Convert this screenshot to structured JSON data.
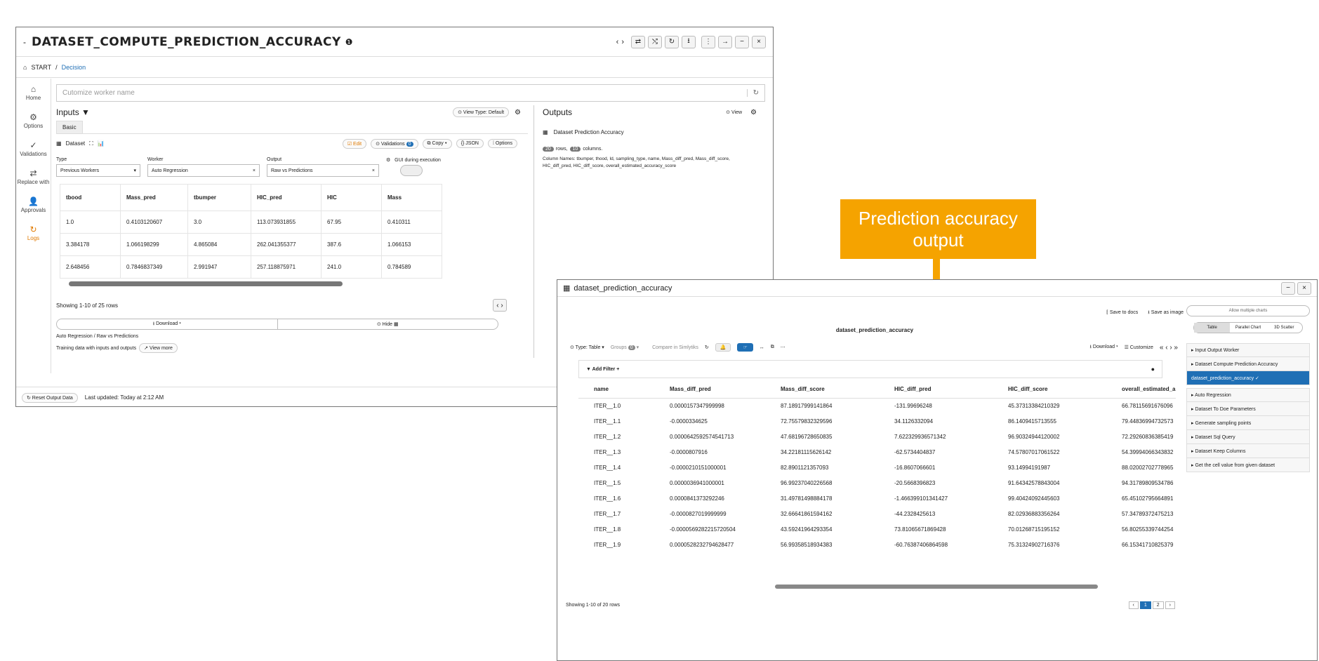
{
  "win1": {
    "title": "DATASET_COMPUTE_PREDICTION_ACCURACY",
    "info": "❶",
    "breadcrumb": {
      "start": "START",
      "sep": "/",
      "current": "Decision"
    },
    "title_controls": [
      "‹",
      "›",
      "⇄",
      "⤭",
      "↻",
      "⭳",
      "⋮",
      "→",
      "−",
      "×"
    ],
    "sidebar": [
      {
        "icon": "⌂",
        "label": "Home"
      },
      {
        "icon": "⚙",
        "label": "Options"
      },
      {
        "icon": "✓",
        "label": "Validations"
      },
      {
        "icon": "⇄",
        "label": "Replace with"
      },
      {
        "icon": "👤",
        "label": "Approvals"
      },
      {
        "icon": "↻",
        "label": "Logs"
      }
    ],
    "worker_name_placeholder": "Cutomize worker name",
    "inputs": {
      "title": "Inputs ▼",
      "view_type": "⊙ View Type: Default",
      "tab": "Basic",
      "dataset_label": "Dataset",
      "buttons": {
        "edit": "☑ Edit",
        "validations": "⊙ Validations",
        "validations_count": "0",
        "copy": "⧉ Copy ▾",
        "json": "{} JSON",
        "options": "⁞ Options"
      },
      "fields": {
        "type_label": "Type",
        "type_value": "Previous Workers",
        "worker_label": "Worker",
        "worker_value": "Auto Regression",
        "output_label": "Output",
        "output_value": "Raw vs Predictions",
        "gui_label": "GUI during execution"
      },
      "table": {
        "headers": [
          "tbood",
          "Mass_pred",
          "tbumper",
          "HIC_pred",
          "HIC",
          "Mass"
        ],
        "rows": [
          [
            "1.0",
            "0.4103120607",
            "3.0",
            "113.073931855",
            "67.95",
            "0.410311"
          ],
          [
            "3.384178",
            "1.066198299",
            "4.865084",
            "262.041355377",
            "387.6",
            "1.066153"
          ],
          [
            "2.648456",
            "0.7846837349",
            "2.991947",
            "257.118875971",
            "241.0",
            "0.784589"
          ]
        ]
      },
      "showing": "Showing 1-10 of 25 rows",
      "download": "⭳ Download ▾",
      "hide": "⊙ Hide ▦",
      "subtitle": "Auto Regression / Raw vs Predictions",
      "training": "Training data with inputs and outputs",
      "view_more": "↗ View more"
    },
    "outputs": {
      "title": "Outputs",
      "view": "⊙ View",
      "dataset_name": "Dataset Prediction Accuracy",
      "rows_count": "20",
      "rows_label": "rows,",
      "cols_count": "10",
      "cols_label": "columns.",
      "column_names": "Column Names: tbumper, thood, Id, sampling_type, name, Mass_diff_pred, Mass_diff_score, HIC_diff_pred, HIC_diff_score, overall_estimated_accuracy_score"
    },
    "footer": {
      "reset": "↻ Reset Output Data",
      "updated": "Last updated: Today at 2:12 AM"
    }
  },
  "callout": "Prediction accuracy output",
  "win2": {
    "title": "dataset_prediction_accuracy",
    "save_docs": "⁅ Save to docs",
    "save_image": "⭳ Save as image",
    "chart_title": "dataset_prediction_accuracy",
    "toolbar": {
      "type": "⊙ Type: Table ▾",
      "groups": "Groups",
      "groups_count": "0",
      "compare": "Compare in Simlytiks",
      "download": "⭳ Download ▾",
      "customize": "☰ Customize",
      "nav": "«  ‹  ›  »"
    },
    "add_filter": "▼ Add Filter +",
    "table": {
      "headers": [
        "name",
        "Mass_diff_pred",
        "Mass_diff_score",
        "HIC_diff_pred",
        "HIC_diff_score",
        "overall_estimated_a"
      ],
      "rows": [
        [
          "ITER__1.0",
          "0.0000157347999998",
          "87.18917999141864",
          "-131.99696248",
          "45.37313384210329",
          "66.78115691676096"
        ],
        [
          "ITER__1.1",
          "-0.0000334625",
          "72.75579832329596",
          "34.1126332094",
          "86.1409415713555",
          "79.44836994732573"
        ],
        [
          "ITER__1.2",
          "0.0000642592574541713",
          "47.68196728650835",
          "7.622329936571342",
          "96.90324944120002",
          "72.29260836385419"
        ],
        [
          "ITER__1.3",
          "-0.0000807916",
          "34.22181115626142",
          "-62.5734404837",
          "74.57807017061522",
          "54.39994066343832"
        ],
        [
          "ITER__1.4",
          "-0.0000210151000001",
          "82.8901121357093",
          "-16.8607066601",
          "93.14994191987",
          "88.02002702778965"
        ],
        [
          "ITER__1.5",
          "0.0000036941000001",
          "96.99237040226568",
          "-20.5668396823",
          "91.64342578843004",
          "94.31789809534786"
        ],
        [
          "ITER__1.6",
          "0.0000841373292246",
          "31.49781498884178",
          "-1.466399101341427",
          "99.40424092445603",
          "65.45102795664891"
        ],
        [
          "ITER__1.7",
          "-0.0000827019999999",
          "32.66641861594162",
          "-44.2328425613",
          "82.02936883356264",
          "57.34789372475213"
        ],
        [
          "ITER__1.8",
          "-0.0000569282215720504",
          "43.59241964293354",
          "73.81065671869428",
          "70.01268715195152",
          "56.80255339744254"
        ],
        [
          "ITER__1.9",
          "0.0000528232794628477",
          "56.99358518934383",
          "-60.76387406864598",
          "75.31324902716376",
          "66.15341710825379"
        ]
      ]
    },
    "showing": "Showing 1-10 of 20 rows",
    "pagination": [
      "‹",
      "1",
      "2",
      "›"
    ],
    "side": {
      "allow_multiple": "Allow multiple charts",
      "view_tabs": [
        "Table",
        "Parallel Chart",
        "3D Scatter"
      ],
      "workers": [
        "▸ Input Output Worker",
        "▸ Dataset Compute Prediction Accuracy",
        "dataset_prediction_accuracy ✓",
        "▸ Auto Regression",
        "▸ Dataset To Doe Parameters",
        "▸ Generate sampling points",
        "▸ Dataset Sql Query",
        "▸ Dataset Keep Columns",
        "▸ Get the cell value from given dataset"
      ]
    }
  },
  "colors": {
    "accent": "#1f6fb5",
    "callout": "#f5a300",
    "active_sidebar": "#e07a00"
  }
}
